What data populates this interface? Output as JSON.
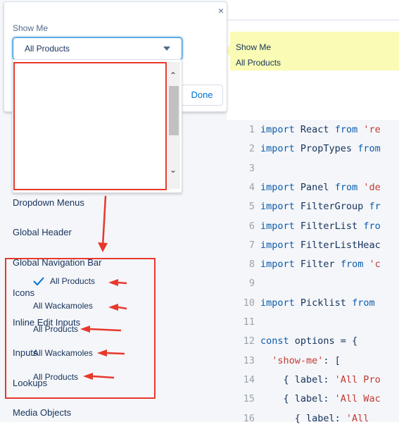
{
  "popover": {
    "label": "Show Me",
    "selected_value": "All Products",
    "done_label": "Done",
    "close_glyph": "×",
    "close_icon": "close-icon",
    "caret_icon": "caret-down-icon"
  },
  "tooltip": {
    "line1": "Show Me",
    "line2": "All Products",
    "background": "#fafbb4"
  },
  "sidebar": {
    "items": [
      {
        "label": "Dropdown Menus"
      },
      {
        "label": "Global Header"
      },
      {
        "label": "Global Navigation Bar"
      },
      {
        "label": "Icons"
      },
      {
        "label": "Inline Edit Inputs"
      },
      {
        "label": "Inputs"
      },
      {
        "label": "Lookups"
      },
      {
        "label": "Media Objects"
      }
    ]
  },
  "dropdown_options": [
    {
      "label": "All Products",
      "selected": true
    },
    {
      "label": "All Wackamoles",
      "selected": false
    },
    {
      "label": "All Products",
      "selected": false
    },
    {
      "label": "All Wackamoles",
      "selected": false
    },
    {
      "label": "All Products",
      "selected": false
    }
  ],
  "annotation_color": "#e8382c",
  "code": {
    "lines": [
      {
        "num": "1",
        "parts": [
          [
            "kw",
            "import "
          ],
          [
            "plain",
            "React "
          ],
          [
            "kw",
            "from "
          ],
          [
            "str",
            "'re"
          ]
        ]
      },
      {
        "num": "2",
        "parts": [
          [
            "kw",
            "import "
          ],
          [
            "plain",
            "PropTypes "
          ],
          [
            "kw",
            "from"
          ]
        ]
      },
      {
        "num": "3",
        "parts": []
      },
      {
        "num": "4",
        "parts": [
          [
            "kw",
            "import "
          ],
          [
            "plain",
            "Panel "
          ],
          [
            "kw",
            "from "
          ],
          [
            "str",
            "'de"
          ]
        ]
      },
      {
        "num": "5",
        "parts": [
          [
            "kw",
            "import "
          ],
          [
            "plain",
            "FilterGroup "
          ],
          [
            "kw",
            "fr"
          ]
        ]
      },
      {
        "num": "6",
        "parts": [
          [
            "kw",
            "import "
          ],
          [
            "plain",
            "FilterList "
          ],
          [
            "kw",
            "fro"
          ]
        ]
      },
      {
        "num": "7",
        "parts": [
          [
            "kw",
            "import "
          ],
          [
            "plain",
            "FilterListHeac"
          ]
        ]
      },
      {
        "num": "8",
        "parts": [
          [
            "kw",
            "import "
          ],
          [
            "plain",
            "Filter "
          ],
          [
            "kw",
            "from "
          ],
          [
            "str",
            "'c"
          ]
        ]
      },
      {
        "num": "9",
        "parts": []
      },
      {
        "num": "10",
        "parts": [
          [
            "kw",
            "import "
          ],
          [
            "plain",
            "Picklist "
          ],
          [
            "kw",
            "from"
          ]
        ]
      },
      {
        "num": "11",
        "parts": []
      },
      {
        "num": "12",
        "parts": [
          [
            "kw",
            "const "
          ],
          [
            "plain",
            "options = {"
          ]
        ]
      },
      {
        "num": "13",
        "parts": [
          [
            "str",
            "  'show-me'"
          ],
          [
            "plain",
            ": ["
          ]
        ]
      },
      {
        "num": "14",
        "parts": [
          [
            "plain",
            "    { label: "
          ],
          [
            "str",
            "'All Pro"
          ]
        ]
      },
      {
        "num": "15",
        "parts": [
          [
            "plain",
            "    { label: "
          ],
          [
            "str",
            "'All Wac"
          ]
        ]
      },
      {
        "num": "16",
        "parts": [
          [
            "plain",
            "      { label: "
          ],
          [
            "str",
            "'All"
          ]
        ]
      }
    ]
  }
}
